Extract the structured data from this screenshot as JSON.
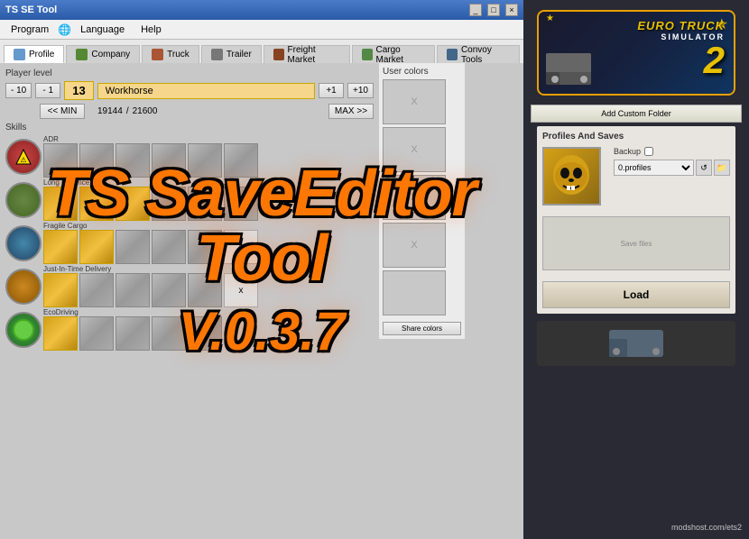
{
  "app": {
    "title": "TS SE Tool",
    "window_controls": [
      "minimize",
      "maximize",
      "close"
    ]
  },
  "menu": {
    "items": [
      "Program",
      "Language",
      "Help"
    ]
  },
  "tabs": [
    {
      "id": "profile",
      "label": "Profile",
      "active": true
    },
    {
      "id": "company",
      "label": "Company"
    },
    {
      "id": "truck",
      "label": "Truck"
    },
    {
      "id": "trailer",
      "label": "Trailer"
    },
    {
      "id": "freight-market",
      "label": "Freight Market"
    },
    {
      "id": "cargo-market",
      "label": "Cargo Market"
    },
    {
      "id": "convoy-tools",
      "label": "Convoy Tools"
    }
  ],
  "player": {
    "level_label": "Player level",
    "minus10": "- 10",
    "minus1": "- 1",
    "level": "13",
    "name": "Workhorse",
    "plus1": "+1",
    "plus10": "+10",
    "min_btn": "<< MIN",
    "max_btn": "MAX >>",
    "xp_current": "19144",
    "xp_max": "21600",
    "xp_separator": "/"
  },
  "user_colors": {
    "label": "User colors",
    "swatch_x": "X",
    "share_btn": "Share colors"
  },
  "skills": {
    "label": "Skills",
    "adr_label": "ADR",
    "long_distance_label": "Long Distance",
    "fragile_label": "Fragile Cargo",
    "just_in_time_label": "Just-In-Time Delivery",
    "ecodriving_label": "EcoDriving"
  },
  "right_panel": {
    "ets2_line1": "EURO TRUCK",
    "ets2_line2": "SIMULATOR",
    "ets2_number": "2",
    "add_folder_btn": "Add Custom Folder",
    "profiles_title": "Profiles And Saves",
    "backup_label": "Backup",
    "profiles_option": "0.profiles",
    "load_btn": "Load"
  },
  "overlay": {
    "title": "TS SaveEditor Tool",
    "version": "V.0.3.7"
  },
  "watermark": {
    "text": "modshost.com/ets2"
  },
  "colors": {
    "orange": "#ff7700",
    "gold": "#d4a017",
    "ets2_gold": "#e8c000",
    "dark_bg": "#2a2a35"
  }
}
